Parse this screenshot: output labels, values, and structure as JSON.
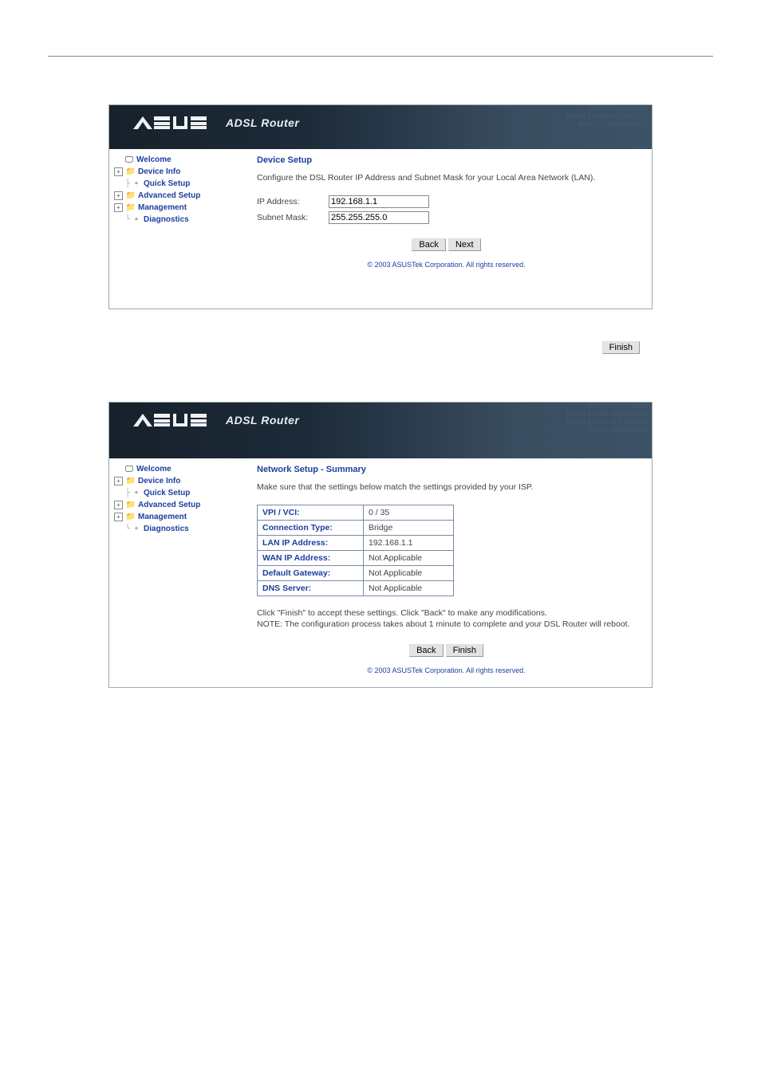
{
  "brand_sub": "ADSL Router",
  "nav": {
    "welcome": "Welcome",
    "device_info": "Device Info",
    "quick_setup": "Quick Setup",
    "advanced_setup": "Advanced Setup",
    "management": "Management",
    "diagnostics": "Diagnostics"
  },
  "panel1": {
    "title": "Device Setup",
    "desc": "Configure the DSL Router IP Address and Subnet Mask for your Local Area Network (LAN).",
    "ip_label": "IP Address:",
    "ip_value": "192.168.1.1",
    "mask_label": "Subnet Mask:",
    "mask_value": "255.255.255.0",
    "back": "Back",
    "next": "Next"
  },
  "mid_finish": "Finish",
  "panel2": {
    "title": "Network Setup - Summary",
    "desc": "Make sure that the settings below match the settings provided by your ISP.",
    "rows": {
      "vpi_k": "VPI / VCI:",
      "vpi_v": "0 / 35",
      "ct_k": "Connection Type:",
      "ct_v": "Bridge",
      "lan_k": "LAN IP Address:",
      "lan_v": "192.168.1.1",
      "wan_k": "WAN IP Address:",
      "wan_v": "Not Applicable",
      "gw_k": "Default Gateway:",
      "gw_v": "Not Applicable",
      "dns_k": "DNS Server:",
      "dns_v": "Not Applicable"
    },
    "note": "Click \"Finish\" to accept these settings. Click \"Back\" to make any modifications.\nNOTE: The configuration process takes about 1 minute to complete and your DSL Router will reboot.",
    "back": "Back",
    "finish": "Finish"
  },
  "copyright": "© 2003 ASUSTek Corporation. All rights reserved."
}
